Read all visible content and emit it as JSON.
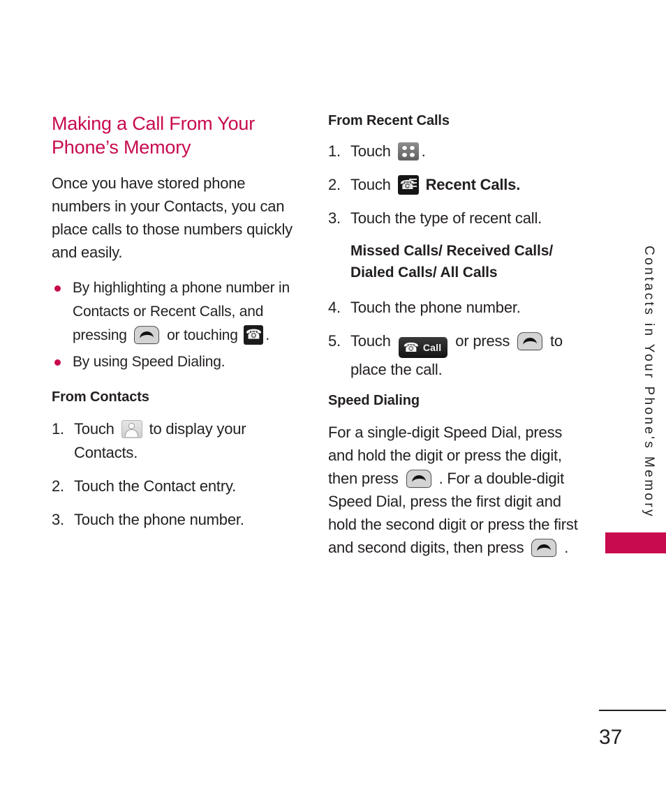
{
  "page": {
    "number": "37",
    "side_tab_label": "Contacts in Your Phone's Memory",
    "accent_color": "#c80a4e",
    "text_color": "#231f20"
  },
  "left_column": {
    "heading": "Making a Call From Your Phone’s Memory",
    "intro_paragraph": "Once you have stored phone numbers in your Contacts, you can place calls to those numbers quickly and easily.",
    "bullets": [
      {
        "text_before": "By highlighting a phone number in Contacts or Recent Calls, and pressing",
        "icon_1": "send-key-icon",
        "text_middle": "or touching",
        "icon_2": "phone-handset-icon",
        "text_after": "."
      },
      {
        "text_before": "By using Speed Dialing.",
        "icon_1": "",
        "text_middle": "",
        "icon_2": "",
        "text_after": ""
      }
    ],
    "subheading": "From Contacts",
    "steps": [
      {
        "num": "1.",
        "text_before": "Touch",
        "icon": "contacts-icon",
        "text_after": "to display your Contacts."
      },
      {
        "num": "2.",
        "text_before": "Touch the Contact entry.",
        "icon": "",
        "text_after": ""
      },
      {
        "num": "3.",
        "text_before": "Touch the phone number.",
        "icon": "",
        "text_after": ""
      }
    ]
  },
  "right_column": {
    "subheading_recent": "From Recent Calls",
    "steps_recent": [
      {
        "num": "1.",
        "text_before": "Touch",
        "icon": "menu-grid-icon",
        "text_after": "."
      },
      {
        "num": "2.",
        "text_before": "Touch",
        "icon": "recent-calls-icon",
        "text_after": "Recent Calls."
      },
      {
        "num": "3.",
        "text_before": "Touch the type of recent call.",
        "icon": "",
        "text_after": ""
      }
    ],
    "call_types": "Missed Calls/ Received Calls/ Dialed Calls/ All Calls",
    "steps_recent_cont": [
      {
        "num": "4.",
        "text_before": "Touch the phone number.",
        "icon": "",
        "text_after": ""
      },
      {
        "num": "5.",
        "text_before": "Touch",
        "icon": "call-button-icon",
        "text_middle": "or press",
        "icon_2": "send-key-icon",
        "text_after": "to place the call."
      }
    ],
    "call_button_label": "Call",
    "subheading_speed": "Speed Dialing",
    "speed_paragraph_1": "For a single-digit Speed Dial, press and hold the digit or press the digit, then press",
    "speed_paragraph_2": ". For a double-digit Speed Dial, press the first digit and hold the second digit or press the first and second digits, then press",
    "speed_paragraph_3": "."
  }
}
